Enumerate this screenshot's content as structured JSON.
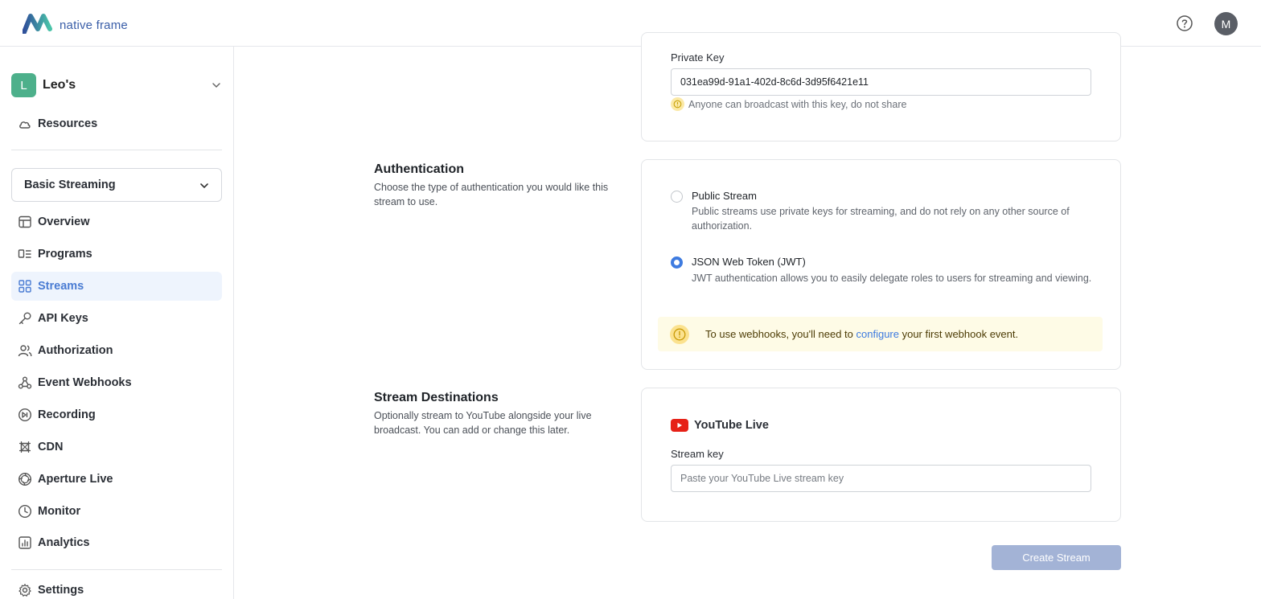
{
  "header": {
    "brand": "native frame",
    "avatar_initial": "M"
  },
  "sidebar": {
    "org_initial": "L",
    "org_name": "Leo's",
    "resources_label": "Resources",
    "product_selected": "Basic Streaming",
    "items": [
      {
        "label": "Overview",
        "icon": "layout-icon"
      },
      {
        "label": "Programs",
        "icon": "programs-icon"
      },
      {
        "label": "Streams",
        "icon": "grid-icon",
        "active": true
      },
      {
        "label": "API Keys",
        "icon": "key-icon"
      },
      {
        "label": "Authorization",
        "icon": "users-icon"
      },
      {
        "label": "Event Webhooks",
        "icon": "webhook-icon"
      },
      {
        "label": "Recording",
        "icon": "recording-icon"
      },
      {
        "label": "CDN",
        "icon": "network-icon"
      },
      {
        "label": "Aperture Live",
        "icon": "aperture-icon"
      },
      {
        "label": "Monitor",
        "icon": "clock-icon"
      },
      {
        "label": "Analytics",
        "icon": "chart-icon"
      }
    ],
    "settings_label": "Settings"
  },
  "private_key": {
    "label": "Private Key",
    "value": "031ea99d-91a1-402d-8c6d-3d95f6421e11",
    "hint": "Anyone can broadcast with this key, do not share"
  },
  "authentication": {
    "title": "Authentication",
    "description": "Choose the type of authentication you would like this stream to use.",
    "options": [
      {
        "title": "Public Stream",
        "description": "Public streams use private keys for streaming, and do not rely on any other source of authorization.",
        "checked": false
      },
      {
        "title": "JSON Web Token (JWT)",
        "description": "JWT authentication allows you to easily delegate roles to users for streaming and viewing.",
        "checked": true
      }
    ],
    "notice_before": "To use webhooks, you'll need to ",
    "notice_link": "configure",
    "notice_after": " your first webhook event."
  },
  "destinations": {
    "title": "Stream Destinations",
    "description": "Optionally stream to YouTube alongside your live broadcast. You can add or change this later.",
    "provider": "YouTube Live",
    "key_label": "Stream key",
    "key_placeholder": "Paste your YouTube Live stream key",
    "key_value": ""
  },
  "actions": {
    "create_label": "Create Stream"
  },
  "colors": {
    "accent": "#3e7be0",
    "active_bg": "#eef4fd",
    "org_badge": "#4db08b",
    "button_disabled": "#a3b3d6",
    "youtube_red": "#e62117",
    "notice_bg": "#fefbe6"
  }
}
